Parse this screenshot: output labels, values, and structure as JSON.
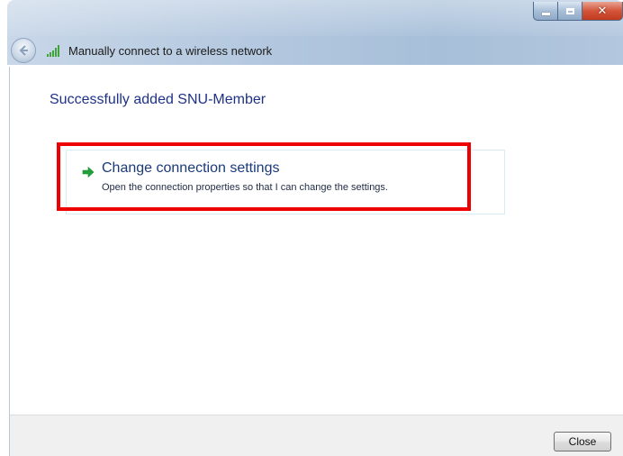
{
  "window": {
    "title": "Manually connect to a wireless network",
    "controls": {
      "minimize_icon": "minimize-icon",
      "maximize_icon": "maximize-icon",
      "close_glyph": "✕"
    }
  },
  "navigation": {
    "back_icon": "back-arrow-icon",
    "network_icon": "wireless-signal-icon"
  },
  "content": {
    "heading": "Successfully added SNU-Member",
    "command_link": {
      "icon": "green-arrow-icon",
      "title": "Change connection settings",
      "description": "Open the connection properties so that I can change the settings."
    }
  },
  "footer": {
    "close_label": "Close"
  },
  "colors": {
    "heading": "#1e3287",
    "highlight": "#ee0000",
    "arrow": "#22a03a"
  }
}
